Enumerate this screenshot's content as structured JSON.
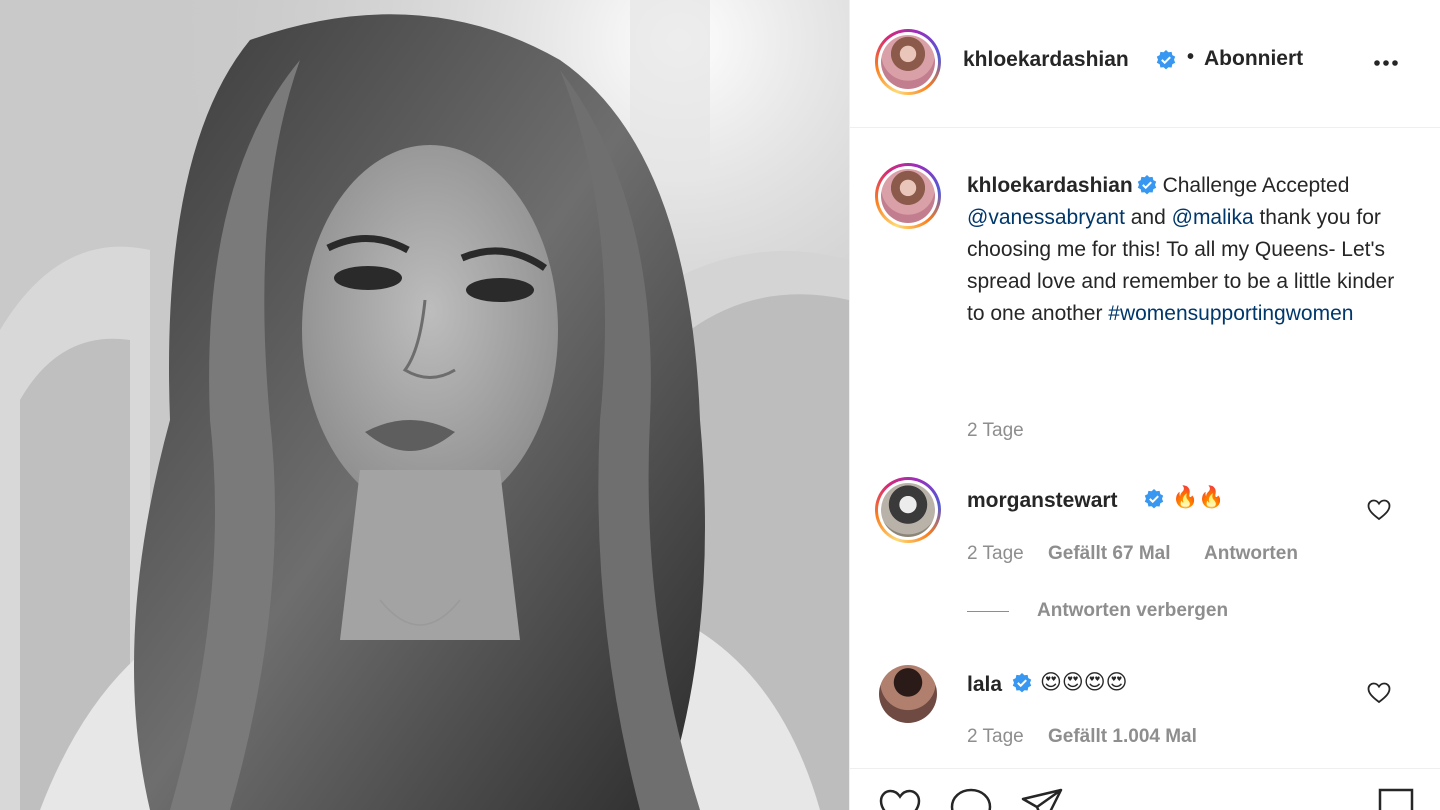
{
  "post": {
    "author": "khloekardashian",
    "follow_state": "Abonniert",
    "separator": "•",
    "caption_text": " Challenge Accepted ",
    "mention_1": "@vanessabryant",
    "mid_text": " and ",
    "mention_2": "@malika",
    "caption_tail": " thank you for choosing me for this! To all my Queens- Let's spread love and remember to be a little kinder to one another  ",
    "hashtag": "#womensupportingwomen",
    "time": "2 Tage"
  },
  "comments": [
    {
      "username": "morganstewart",
      "text": "🔥🔥",
      "time": "2 Tage",
      "likes": "Gefällt 67 Mal",
      "reply_label": "Antworten"
    },
    {
      "username": "lala",
      "text": "😍😍😍😍",
      "time": "2 Tage",
      "likes": "Gefällt 1.004 Mal"
    }
  ],
  "replies_toggle": "Antworten verbergen",
  "icons": {
    "verified": "verified-badge-icon",
    "more": "more-options-icon",
    "like": "heart-icon",
    "comment": "comment-icon",
    "share": "share-icon",
    "save": "bookmark-icon"
  },
  "colors": {
    "verified": "#3897f0",
    "link": "#00376b",
    "muted": "#8e8e8e",
    "text": "#262626"
  }
}
